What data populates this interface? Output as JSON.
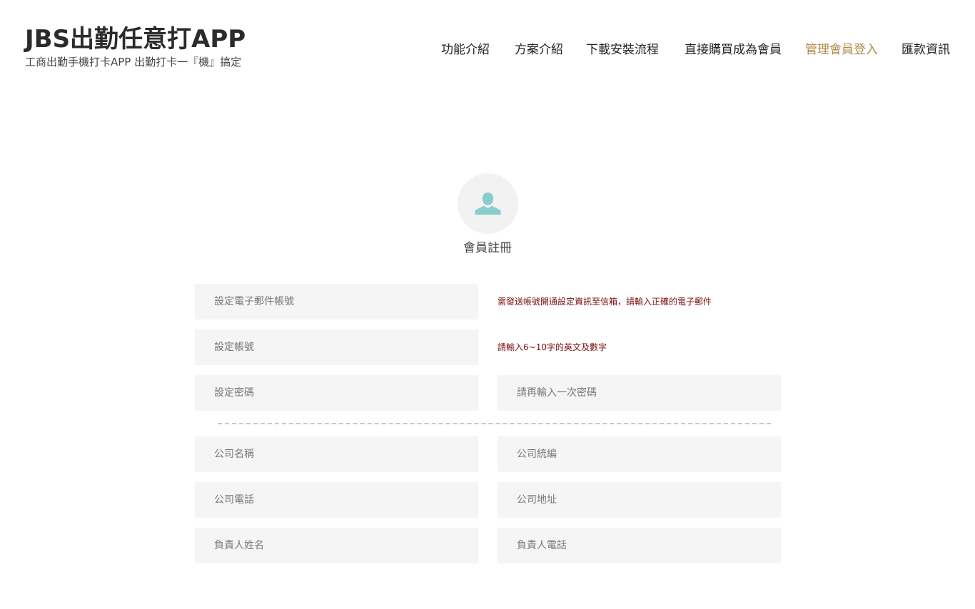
{
  "header": {
    "title": "JBS出勤任意打APP",
    "tagline": "工商出勤手機打卡APP  出勤打卡一『機』搞定"
  },
  "nav": {
    "items": [
      {
        "label": "功能介紹"
      },
      {
        "label": "方案介紹"
      },
      {
        "label": "下載安裝流程"
      },
      {
        "label": "直接購買成為會員"
      },
      {
        "label": "管理會員登入"
      },
      {
        "label": "匯款資訊"
      }
    ],
    "active_color": "#b08a4a"
  },
  "register": {
    "icon": "user-icon",
    "title": "會員註冊"
  },
  "form": {
    "email_placeholder": "設定電子郵件帳號",
    "email_hint": "需發送帳號開通設定資訊至信箱，請輸入正確的電子郵件",
    "account_placeholder": "設定帳號",
    "account_hint": "請輸入6~10字的英文及數字",
    "password_placeholder": "設定密碼",
    "password_confirm_placeholder": "請再輸入一次密碼",
    "company_name_placeholder": "公司名稱",
    "company_tax_id_placeholder": "公司統編",
    "company_phone_placeholder": "公司電話",
    "company_address_placeholder": "公司地址",
    "owner_name_placeholder": "負責人姓名",
    "owner_phone_placeholder": "負責人電話",
    "hint_color": "#7a0e0e",
    "field_bg": "#f5f5f5"
  }
}
